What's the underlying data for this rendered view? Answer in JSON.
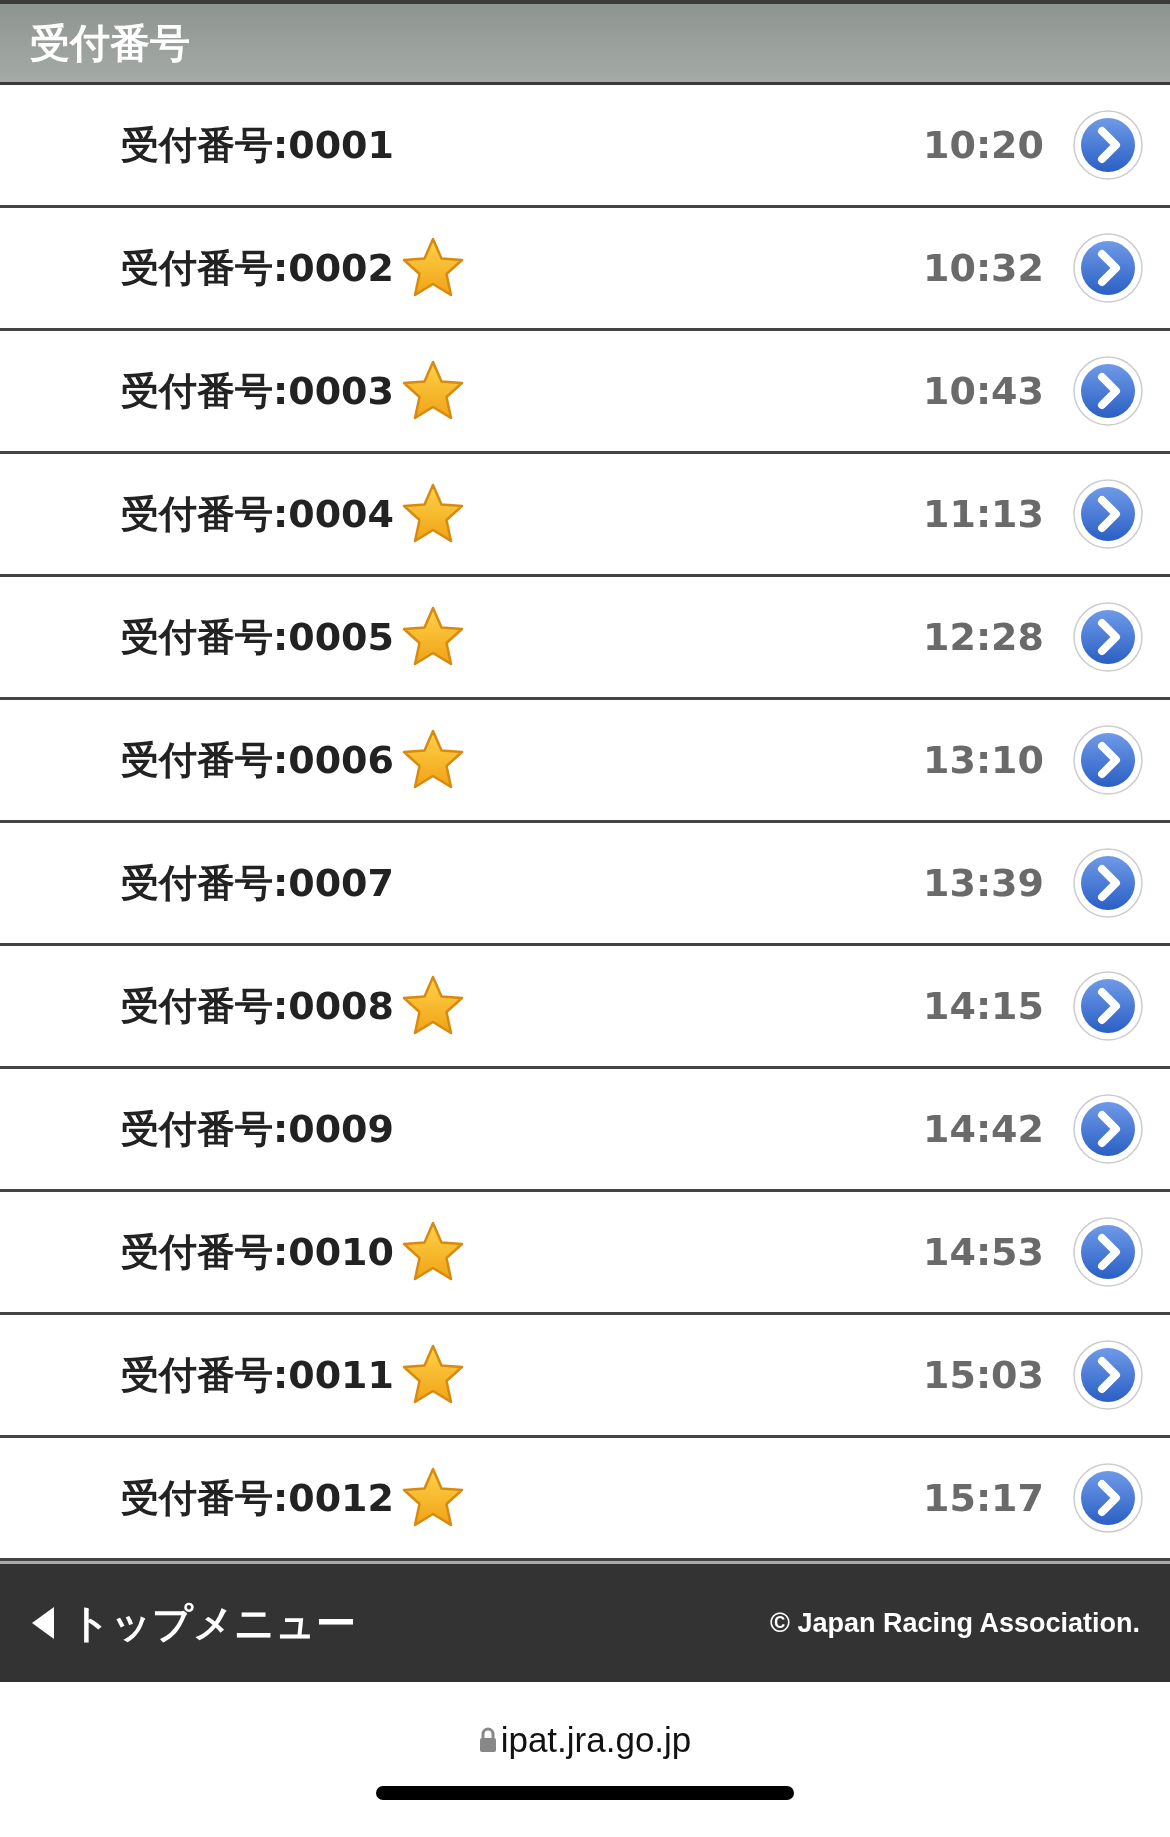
{
  "header": {
    "title": "受付番号"
  },
  "rows": [
    {
      "label": "受付番号:0001",
      "starred": false,
      "time": "10:20"
    },
    {
      "label": "受付番号:0002",
      "starred": true,
      "time": "10:32"
    },
    {
      "label": "受付番号:0003",
      "starred": true,
      "time": "10:43"
    },
    {
      "label": "受付番号:0004",
      "starred": true,
      "time": "11:13"
    },
    {
      "label": "受付番号:0005",
      "starred": true,
      "time": "12:28"
    },
    {
      "label": "受付番号:0006",
      "starred": true,
      "time": "13:10"
    },
    {
      "label": "受付番号:0007",
      "starred": false,
      "time": "13:39"
    },
    {
      "label": "受付番号:0008",
      "starred": true,
      "time": "14:15"
    },
    {
      "label": "受付番号:0009",
      "starred": false,
      "time": "14:42"
    },
    {
      "label": "受付番号:0010",
      "starred": true,
      "time": "14:53"
    },
    {
      "label": "受付番号:0011",
      "starred": true,
      "time": "15:03"
    },
    {
      "label": "受付番号:0012",
      "starred": true,
      "time": "15:17"
    }
  ],
  "footer": {
    "back_link": "トップメニュー",
    "copyright": "© Japan Racing Association."
  },
  "browser": {
    "url": "ipat.jra.go.jp"
  }
}
